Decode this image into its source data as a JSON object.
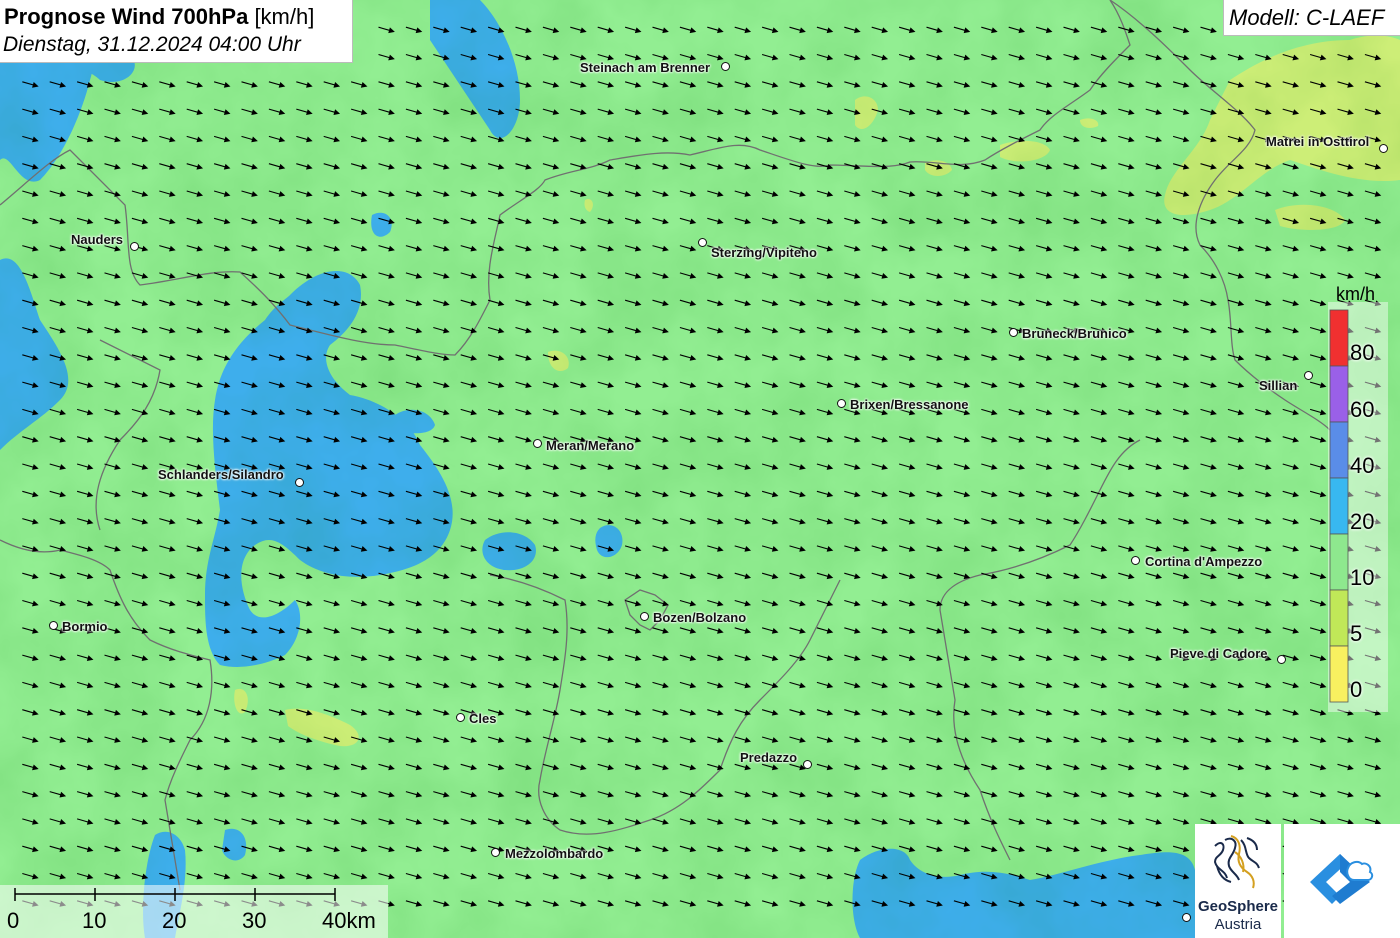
{
  "title": {
    "main": "Prognose Wind 700hPa",
    "unit": "[km/h]",
    "date": "Dienstag, 31.12.2024 04:00 Uhr"
  },
  "model": "Modell: C-LAEF",
  "cities": [
    {
      "name": "Steinach am Brenner"
    },
    {
      "name": "Matrei in Osttirol"
    },
    {
      "name": "Nauders"
    },
    {
      "name": "Sterzing/Vipiteno"
    },
    {
      "name": "Bruneck/Brunico"
    },
    {
      "name": "Sillian"
    },
    {
      "name": "Brixen/Bressanone"
    },
    {
      "name": "Meran/Merano"
    },
    {
      "name": "Schlanders/Silandro"
    },
    {
      "name": "Cortina d'Ampezzo"
    },
    {
      "name": "Bormio"
    },
    {
      "name": "Bozen/Bolzano"
    },
    {
      "name": "Pieve di Cadore"
    },
    {
      "name": "Cles"
    },
    {
      "name": "Predazzo"
    },
    {
      "name": "Mezzolombardo"
    }
  ],
  "legend": {
    "unit": "km/h",
    "labels": [
      "80",
      "60",
      "40",
      "20",
      "10",
      "5",
      "0"
    ],
    "colors": [
      "#f03030",
      "#9a60e8",
      "#5a8de8",
      "#38b8f0",
      "#8ee88e",
      "#c0e858",
      "#f8f060"
    ]
  },
  "scale": {
    "labels": [
      "0",
      "10",
      "20",
      "30",
      "40km"
    ]
  },
  "logo": {
    "name": "GeoSphere",
    "sub": "Austria"
  },
  "colors": {
    "calm": "#f3f06a",
    "light": "#cdee77",
    "moderate": "#95ec95",
    "fresh": "#3eaeec",
    "border": "#707070",
    "arrow": "#000000"
  },
  "wind": {
    "direction": "from west-northwest (arrows pointing east-southeast)"
  }
}
